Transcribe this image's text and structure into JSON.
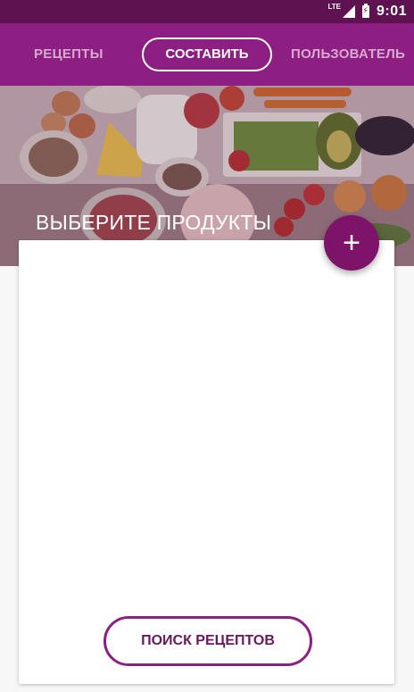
{
  "status_bar": {
    "network": "LTE",
    "time": "9:01"
  },
  "tabs": {
    "left": "РЕЦЕПТЫ",
    "active": "СОСТАВИТЬ",
    "right": "ПОЛЬЗОВАТЕЛЬ"
  },
  "hero": {
    "title": "ВЫБЕРИТЕ ПРОДУКТЫ"
  },
  "actions": {
    "add_symbol": "+",
    "search_label": "ПОИСК РЕЦЕПТОВ"
  },
  "colors": {
    "status_bg": "#5e1250",
    "tab_bg": "#8e1f82",
    "accent": "#7d1469"
  },
  "icons": {
    "signal": "signal-icon",
    "battery": "battery-charging-icon",
    "add": "plus-icon"
  }
}
